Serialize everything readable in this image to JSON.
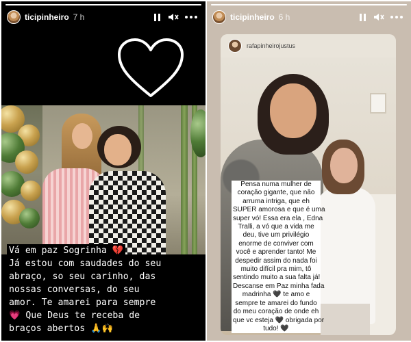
{
  "stories": [
    {
      "username": "ticipinheiro",
      "time": "7 h",
      "progress": 1.0,
      "caption_lines": [
        "Vá em paz Sogrinha 💔",
        "Já estou com saudades do seu",
        "abraço, so seu carinho, das",
        "nossas conversas, do seu",
        "amor. Te amarei para sempre",
        "💗 Que Deus te receba de",
        "braços abertos 🙏🙌"
      ]
    },
    {
      "username": "ticipinheiro",
      "time": "6 h",
      "progress": 1.0,
      "reshared_username": "rafapinheirojustus",
      "caption_lines": [
        "Pensa numa mulher de",
        "coração gigante, que não",
        "arruma intriga, que eh",
        "SUPER amorosa e que é uma",
        "super vó! Essa era ela , Edna",
        "Tralli, a vó que a vida me",
        "deu, tive um privilégio",
        "enorme de conviver com",
        "você e aprender tanto! Me",
        "despedir assim do nada foi",
        "muito difícil pra mim, tô",
        "sentindo muito a sua falta já!",
        "Descanse em Paz minha fada",
        "madrinha 🖤 te amo e",
        "sempre te amarei do fundo",
        "do meu coração de onde eh",
        "que vc esteja 🖤 obrigada por",
        "tudo! 🖤"
      ]
    }
  ],
  "icons": {
    "pause": "pause-icon",
    "mute": "speaker-muted-icon",
    "more": "more-horizontal-icon",
    "heart": "heart-outline-icon"
  },
  "colors": {
    "story1_background": "#000000",
    "story2_background": "#c9bdb0",
    "text_light": "#ffffff",
    "text_dark": "#111111"
  }
}
